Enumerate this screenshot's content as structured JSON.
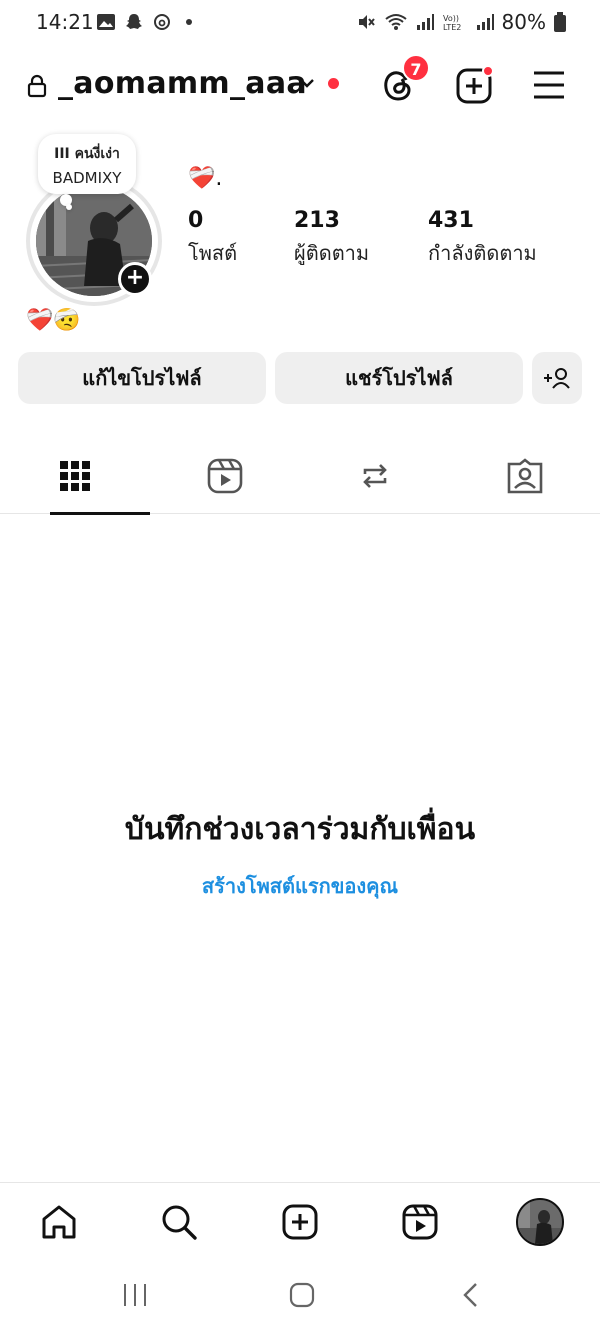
{
  "status_bar": {
    "time": "14:21",
    "battery": "80%",
    "left_icons": [
      "gallery-icon",
      "snapchat-icon",
      "threads-icon",
      "dot"
    ],
    "right_icons": [
      "mute-icon",
      "wifi-icon",
      "signal-icon",
      "volte-icon",
      "signal-icon",
      "battery-icon"
    ]
  },
  "header": {
    "username": "_aomamm_aaa",
    "notification_count": "7",
    "accent": "#ff3040"
  },
  "profile": {
    "note_line1": "III คนงี่เง่า",
    "note_line2": "BADMIXY",
    "display_name": "❤️‍🩹.",
    "bio": "❤️‍🩹🤕",
    "stats": [
      {
        "value": "0",
        "label": "โพสต์"
      },
      {
        "value": "213",
        "label": "ผู้ติดตาม"
      },
      {
        "value": "431",
        "label": "กำลังติดตาม"
      }
    ]
  },
  "buttons": {
    "edit_profile": "แก้ไขโปรไฟล์",
    "share_profile": "แชร์โปรไฟล์"
  },
  "tabs": [
    "grid-icon",
    "reels-icon",
    "reposts-icon",
    "tagged-icon"
  ],
  "empty_state": {
    "title": "บันทึกช่วงเวลาร่วมกับเพื่อน",
    "link": "สร้างโพสต์แรกของคุณ",
    "link_color": "#1d8fe0"
  },
  "bottom_nav": [
    "home-icon",
    "search-icon",
    "create-icon",
    "reels-icon",
    "profile-avatar"
  ]
}
